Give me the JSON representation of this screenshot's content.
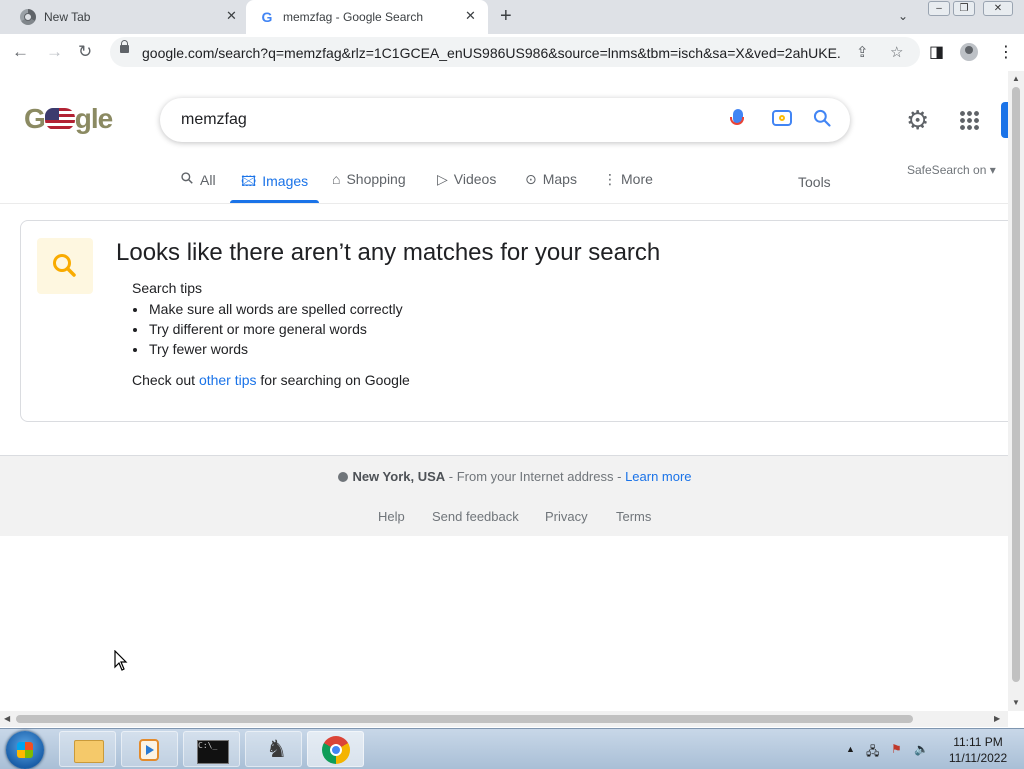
{
  "browser": {
    "tabs": [
      {
        "title": "New Tab",
        "active": false
      },
      {
        "title": "memzfag - Google Search",
        "active": true
      }
    ],
    "new_tab_glyph": "+",
    "url": "google.com/search?q=memzfag&rlz=1C1GCEA_enUS986US986&source=lnms&tbm=isch&sa=X&ved=2ahUKE...",
    "icons": [
      "back-arrow-icon",
      "forward-arrow-icon",
      "reload-icon",
      "lock-icon",
      "share-icon",
      "star-icon",
      "side-panel-icon",
      "profile-icon",
      "kebab-menu-icon"
    ]
  },
  "google": {
    "logo_text": "gle",
    "query": "memzfag",
    "nav_tabs": [
      {
        "label": "All",
        "icon": "search-icon",
        "active": false
      },
      {
        "label": "Images",
        "icon": "image-icon",
        "active": true
      },
      {
        "label": "Shopping",
        "icon": "tag-icon",
        "active": false
      },
      {
        "label": "Videos",
        "icon": "play-icon",
        "active": false
      },
      {
        "label": "Maps",
        "icon": "map-pin-icon",
        "active": false
      },
      {
        "label": "More",
        "icon": "more-vert-icon",
        "active": false
      }
    ],
    "tools_label": "Tools",
    "safesearch_label": "SafeSearch on"
  },
  "results": {
    "title": "Looks like there aren’t any matches for your search",
    "tips_title": "Search tips",
    "tips": [
      "Make sure all words are spelled correctly",
      "Try different or more general words",
      "Try fewer words"
    ],
    "checkout_before": "Check out ",
    "checkout_link": "other tips",
    "checkout_after": " for searching on Google"
  },
  "footer": {
    "location": "New York, USA",
    "location_note": " - From your Internet address - ",
    "learn_more": "Learn more",
    "links": [
      "Help",
      "Send feedback",
      "Privacy",
      "Terms"
    ]
  },
  "taskbar": {
    "apps": [
      "file-explorer",
      "media-player",
      "command-prompt",
      "chess",
      "google-chrome"
    ],
    "time": "11:11 PM",
    "date": "11/11/2022"
  },
  "colors": {
    "accent": "#1a73e8",
    "tab_strip": "#dee1e6",
    "footer_bg": "#f2f2f2",
    "nomatch_icon_bg": "#fef7e0",
    "nomatch_icon": "#f9ab00"
  }
}
